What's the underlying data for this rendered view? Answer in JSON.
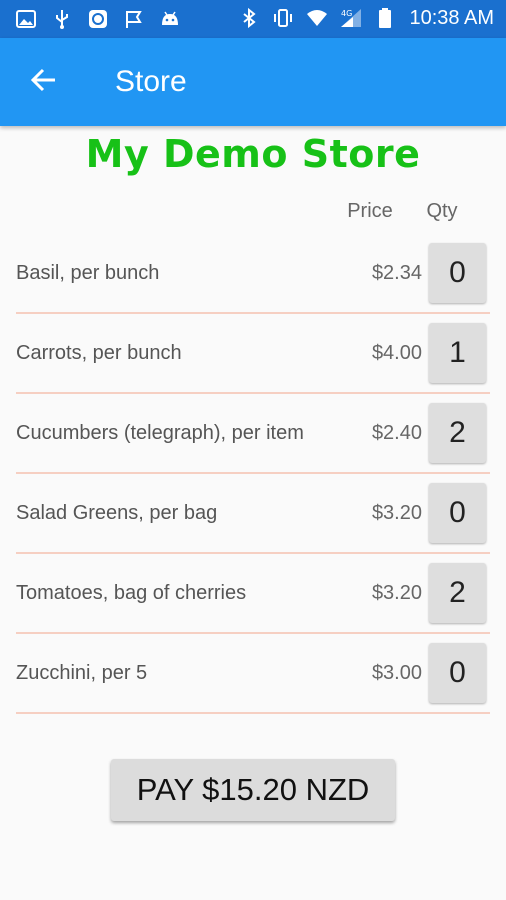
{
  "status_bar": {
    "time": "10:38 AM",
    "network": "4G"
  },
  "app_bar": {
    "title": "Store"
  },
  "store": {
    "title": "My Demo Store",
    "price_header": "Price",
    "qty_header": "Qty"
  },
  "items": [
    {
      "name": "Basil, per bunch",
      "price": "$2.34",
      "qty": "0"
    },
    {
      "name": "Carrots, per bunch",
      "price": "$4.00",
      "qty": "1"
    },
    {
      "name": "Cucumbers (telegraph), per item",
      "price": "$2.40",
      "qty": "2"
    },
    {
      "name": "Salad Greens, per bag",
      "price": "$3.20",
      "qty": "0"
    },
    {
      "name": "Tomatoes, bag of cherries",
      "price": "$3.20",
      "qty": "2"
    },
    {
      "name": "Zucchini, per 5",
      "price": "$3.00",
      "qty": "0"
    }
  ],
  "pay_button": {
    "label": "PAY $15.20 NZD"
  },
  "colors": {
    "status_bar": "#1a70cf",
    "app_bar": "#2196f3",
    "store_title": "#17c117",
    "divider": "#f6cfc2",
    "button": "#dedede"
  }
}
